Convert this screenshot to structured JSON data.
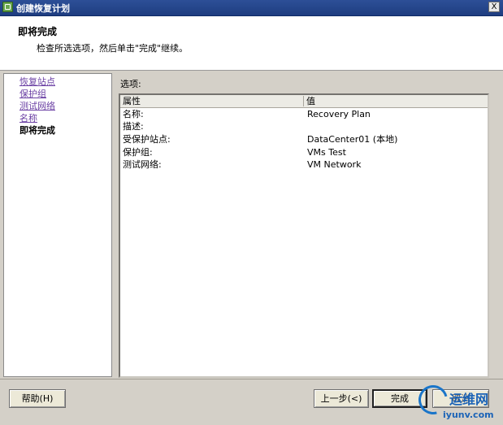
{
  "window": {
    "title": "创建恢复计划",
    "close_glyph": "X"
  },
  "header": {
    "title": "即将完成",
    "description": "检查所选选项，然后单击\"完成\"继续。"
  },
  "steps": [
    {
      "label": "恢复站点",
      "state": "link"
    },
    {
      "label": "保护组",
      "state": "link"
    },
    {
      "label": "测试网络",
      "state": "link"
    },
    {
      "label": "名称",
      "state": "link"
    },
    {
      "label": "即将完成",
      "state": "current"
    }
  ],
  "options": {
    "label": "选项:",
    "columns": [
      "属性",
      "值"
    ],
    "rows": [
      {
        "key": "名称:",
        "value": "Recovery Plan"
      },
      {
        "key": "描述:",
        "value": ""
      },
      {
        "key": "受保护站点:",
        "value": "DataCenter01 (本地)"
      },
      {
        "key": "保护组:",
        "value": "VMs Test"
      },
      {
        "key": "测试网络:",
        "value": "VM Network"
      }
    ]
  },
  "buttons": {
    "help": "帮助(H)",
    "back": "上一步(<)",
    "finish": "完成",
    "cancel": "取消"
  },
  "watermark": {
    "brand": "运维网",
    "url": "iyunv.com"
  }
}
